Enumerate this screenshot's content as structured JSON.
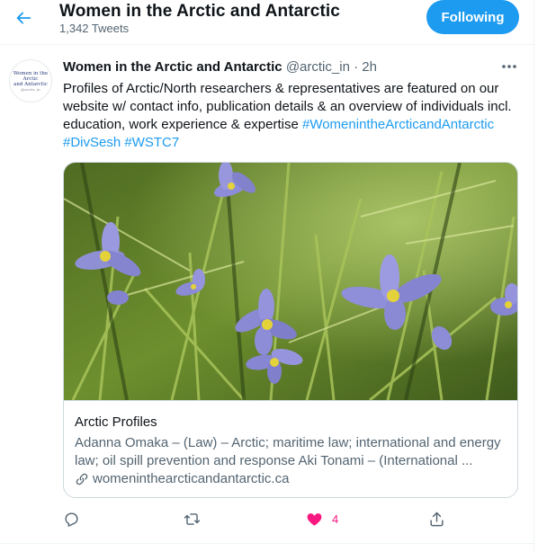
{
  "header": {
    "title": "Women in the Arctic and Antarctic",
    "tweet_count": "1,342 Tweets",
    "follow_label": "Following",
    "back_icon": "back-arrow-icon"
  },
  "tweet": {
    "author_name": "Women in the Arctic and Antarctic",
    "handle": "@arctic_in",
    "separator": "·",
    "time": "2h",
    "avatar": {
      "line1": "Women in the Arctic",
      "line2": "and Antarctic",
      "line3": "@arctic_in"
    },
    "text_lines": [
      "Profiles of Arctic/North researchers & representatives are featured on our",
      "website w/ contact info, publication details & an overview of individuals incl.",
      "education, work experience & expertise "
    ],
    "hashtags": [
      "#WomenintheArcticandAntarctic",
      "#DivSesh",
      "#WSTC7"
    ],
    "card": {
      "title": "Arctic Profiles",
      "description_lines": [
        "Adanna Omaka – (Law) – Arctic; maritime law; international and energy",
        "law; oil spill prevention and response Aki Tonami – (International ..."
      ],
      "link": "womeninthearcticandantarctic.ca"
    },
    "actions": {
      "reply_icon": "reply-icon",
      "retweet_icon": "retweet-icon",
      "like_icon": "heart-icon",
      "like_count": "4",
      "share_icon": "share-icon",
      "like_color": "#f91880"
    }
  },
  "colors": {
    "accent": "#1d9bf0",
    "text_primary": "#0f1419",
    "text_secondary": "#536471",
    "border": "#cfd9de"
  }
}
